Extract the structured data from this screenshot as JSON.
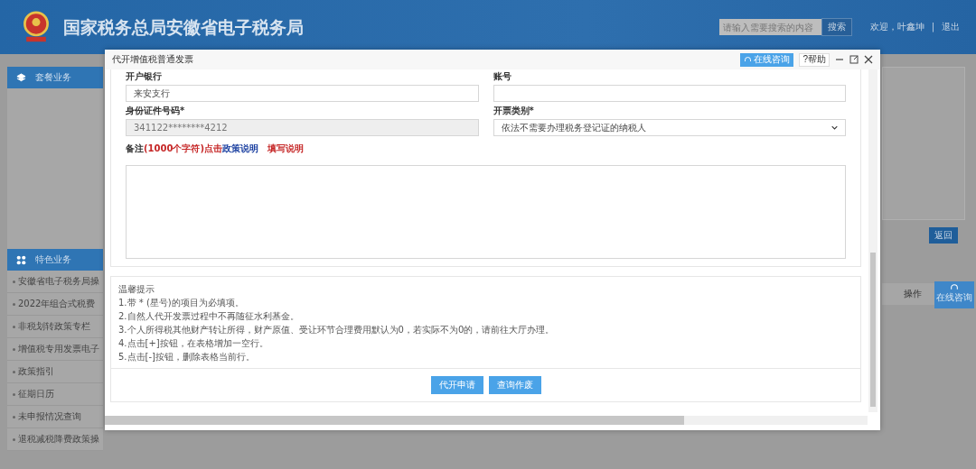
{
  "header": {
    "title": "国家税务总局安徽省电子税务局",
    "search": {
      "placeholder": "请输入需要搜索的内容"
    },
    "search_button": "搜索",
    "welcome": "欢迎，叶鑫坤",
    "separator": "|",
    "logout": "退出"
  },
  "sidebar": {
    "package_title": "套餐业务",
    "feature_title": "特色业务",
    "items": [
      "安徽省电子税务局操",
      "2022年组合式税费",
      "非税划转政策专栏",
      "增值税专用发票电子",
      "政策指引",
      "征期日历",
      "未申报情况查询",
      "退税减税降费政策操"
    ]
  },
  "background": {
    "back_button": "返回",
    "column_header": "操作",
    "consult_button": "在线咨询"
  },
  "dialog": {
    "title": "代开增值税普通发票",
    "consult_button": "在线咨询",
    "help_button": "?帮助",
    "fields": [
      {
        "label": "开户银行",
        "kind": "text",
        "value": "来安支行",
        "disabled": false
      },
      {
        "label": "账号",
        "kind": "text",
        "disabled": false
      },
      {
        "label": "身份证件号码*",
        "kind": "text",
        "value": "341122********4212",
        "disabled": true
      },
      {
        "label": "开票类别*",
        "kind": "select",
        "value": "依法不需要办理税务登记证的纳税人",
        "disabled": false
      }
    ],
    "remark": {
      "label": "备注",
      "limit": "(1000个字符)",
      "hint": "点击",
      "policy_link": "政策说明",
      "fill_link": "填写说明"
    },
    "tips": {
      "title": "温馨提示",
      "lines": [
        "1.带 * (星号)的项目为必填项。",
        "2.自然人代开发票过程中不再随征水利基金。",
        "3.个人所得税其他财产转让所得，财产原值、受让环节合理费用默认为0，若实际不为0的，请前往大厅办理。",
        "4.点击[+]按钮，在表格增加一空行。",
        "5.点击[-]按钮，删除表格当前行。"
      ]
    },
    "buttons": [
      "代开申请",
      "查询作废"
    ]
  }
}
